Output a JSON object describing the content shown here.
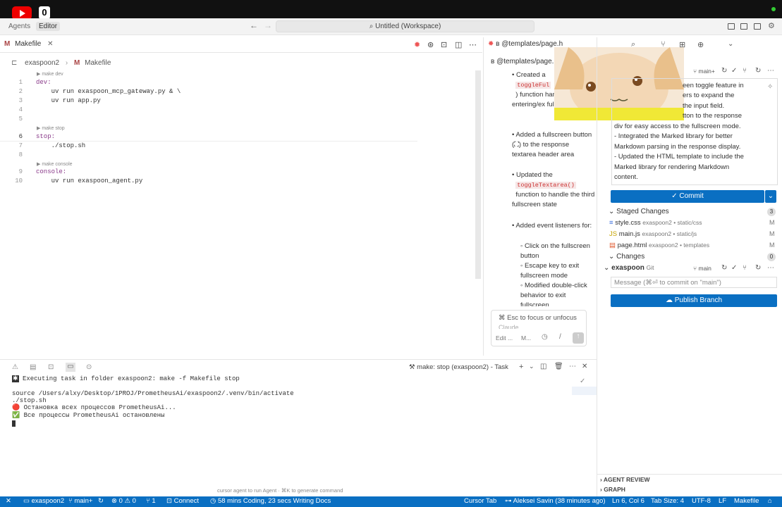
{
  "overlay": {
    "notification_count": "0"
  },
  "titlebar": {
    "agents": "Agents",
    "editor": "Editor",
    "search": "Untitled (Workspace)"
  },
  "editor": {
    "tab": "Makefile",
    "breadcrumb": [
      "exaspoon2",
      "Makefile"
    ],
    "lines": [
      {
        "n": "1",
        "code": "dev:"
      },
      {
        "n": "2",
        "code": "    uv run exaspoon_mcp_gateway.py & \\"
      },
      {
        "n": "3",
        "code": "    uv run app.py"
      },
      {
        "n": "4",
        "code": ""
      },
      {
        "n": "5",
        "code": ""
      },
      {
        "n": "6",
        "code": "stop:"
      },
      {
        "n": "7",
        "code": "    ./stop.sh"
      },
      {
        "n": "8",
        "code": ""
      },
      {
        "n": "9",
        "code": "console:"
      },
      {
        "n": "10",
        "code": "    uv run exaspoon_agent.py"
      }
    ],
    "codelens": [
      "▶ make dev",
      "▶ make stop",
      "▶ make console"
    ]
  },
  "chat": {
    "tab": "@templates/page.h",
    "subtab": "@templates/page.h",
    "items": [
      {
        "text": "Created a",
        "chip": "toggleFul",
        "after": ") function handles entering/ex fullscreen mode"
      },
      {
        "text": "Added a fullscreen button (⛶) to the response textarea header area"
      },
      {
        "text": "Updated the",
        "chip": "toggleTextarea()",
        "after": "function to handle the third fullscreen state"
      },
      {
        "text": "Added event listeners for:"
      }
    ],
    "subitems": [
      "Click on the fullscreen button",
      "Escape key to exit fullscreen mode",
      "Modified double-click behavior to exit fullscreen"
    ],
    "input_hint": "⌘ Esc to focus or unfocus",
    "input_hint2": "Claude",
    "input_edit": "Edit ...",
    "input_model": "M..."
  },
  "scm": {
    "branch": "main+",
    "message_lines": [
      "een toggle feature in",
      "ers to expand the",
      "the input field.",
      "tton to the response",
      "div for easy access to the fullscreen mode.",
      "- Integrated the Marked library for better",
      "Markdown parsing in the response display.",
      "- Updated the HTML template to include the",
      "Marked library for rendering Markdown",
      "content."
    ],
    "commit": "Commit",
    "staged_title": "Staged Changes",
    "staged_count": "3",
    "staged": [
      {
        "name": "style.css",
        "meta": "exaspoon2 • static/css",
        "status": "M"
      },
      {
        "name": "main.js",
        "meta": "exaspoon2 • static/js",
        "status": "M"
      },
      {
        "name": "page.html",
        "meta": "exaspoon2 • templates",
        "status": "M"
      }
    ],
    "changes_title": "Changes",
    "changes_count": "0",
    "repo": "exaspoon",
    "repo_git": "Git",
    "repo_branch": "main",
    "message_placeholder": "Message (⌘⏎ to commit on \"main\")",
    "publish": "Publish Branch",
    "agent_review": "AGENT REVIEW",
    "graph": "GRAPH"
  },
  "terminal": {
    "task_label": "make: stop (exaspoon2) - Task",
    "lines": [
      "Executing task in folder exaspoon2: make -f Makefile stop",
      "",
      "source /Users/alxy/Desktop/1PROJ/PrometheusAi/exaspoon2/.venv/bin/activate",
      "./stop.sh",
      "🔴 Остановка всех процессов PrometheusAi...",
      "✅ Все процессы PrometheusAi остановлены"
    ],
    "hint": "cursor agent to run Agent · ⌘K to generate command"
  },
  "status": {
    "folder": "exaspoon2",
    "branch": "main+",
    "problems": "⊗ 0 ⚠ 0",
    "ports": "1",
    "connect": "Connect",
    "time": "58 mins Coding, 23 secs Writing Docs",
    "cursor_tab": "Cursor Tab",
    "author": "Aleksei Savin (38 minutes ago)",
    "position": "Ln 6, Col 6",
    "tabsize": "Tab Size: 4",
    "encoding": "UTF-8",
    "eol": "LF",
    "language": "Makefile"
  },
  "colors": {
    "accent": "#0a6fc2",
    "status_bar": "#0a6fc2"
  }
}
